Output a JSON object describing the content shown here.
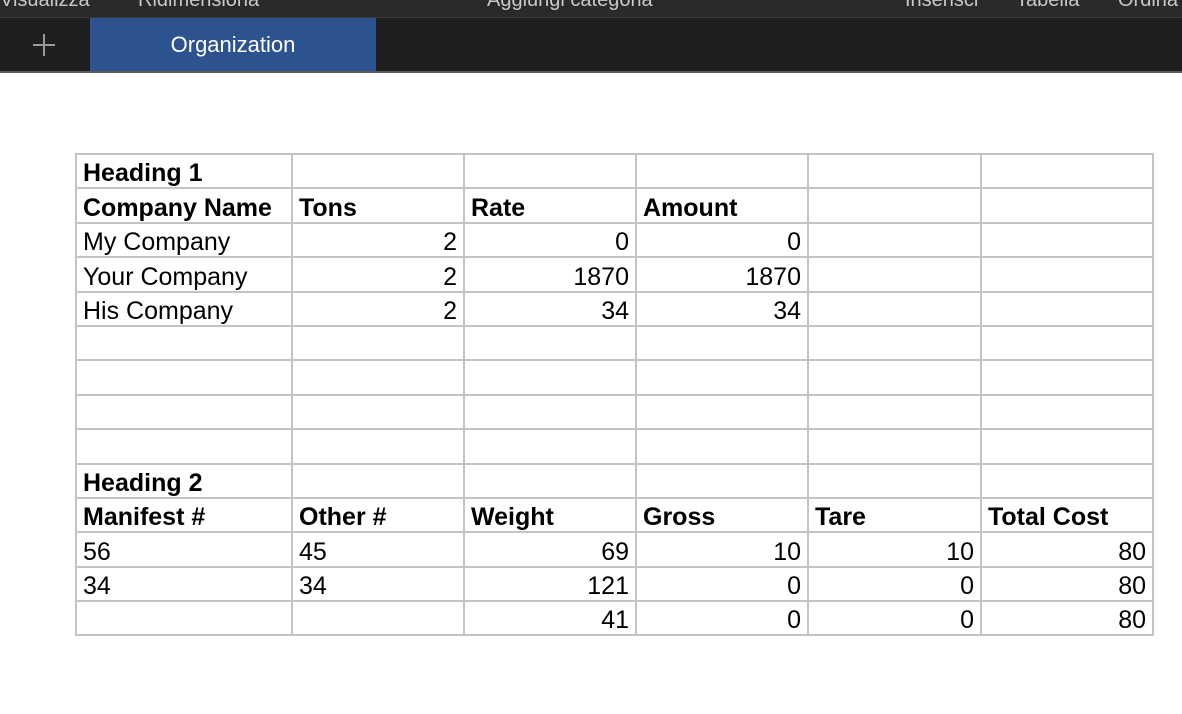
{
  "menu": {
    "items": [
      "Visualizza",
      "Ridimensiona",
      "Aggiungi categoria",
      "Inserisci",
      "Tabella",
      "Ordina"
    ]
  },
  "tabs": {
    "add_icon": "plus-icon",
    "active_label": "Organization"
  },
  "sheet": {
    "rows": [
      [
        "Heading 1",
        "",
        "",
        "",
        "",
        ""
      ],
      [
        "Company Name",
        "Tons",
        "Rate",
        "Amount",
        "",
        ""
      ],
      [
        "My Company",
        "2",
        "0",
        "0",
        "",
        ""
      ],
      [
        "Your Company",
        "2",
        "1870",
        "1870",
        "",
        ""
      ],
      [
        "His Company",
        "2",
        "34",
        "34",
        "",
        ""
      ],
      [
        "",
        "",
        "",
        "",
        "",
        ""
      ],
      [
        "",
        "",
        "",
        "",
        "",
        ""
      ],
      [
        "",
        "",
        "",
        "",
        "",
        ""
      ],
      [
        "",
        "",
        "",
        "",
        "",
        ""
      ],
      [
        "Heading 2",
        "",
        "",
        "",
        "",
        ""
      ],
      [
        "Manifest #",
        "Other #",
        "Weight",
        "Gross",
        "Tare",
        "Total Cost"
      ],
      [
        "56",
        "45",
        "69",
        "10",
        "10",
        "80"
      ],
      [
        "34",
        "34",
        "121",
        "0",
        "0",
        "80"
      ],
      [
        "",
        "",
        "41",
        "0",
        "0",
        "80"
      ]
    ]
  },
  "colors": {
    "tab_active_bg": "#2d5290",
    "tabbar_bg": "#1f1f1f",
    "grid_line": "#c4c4c4"
  }
}
